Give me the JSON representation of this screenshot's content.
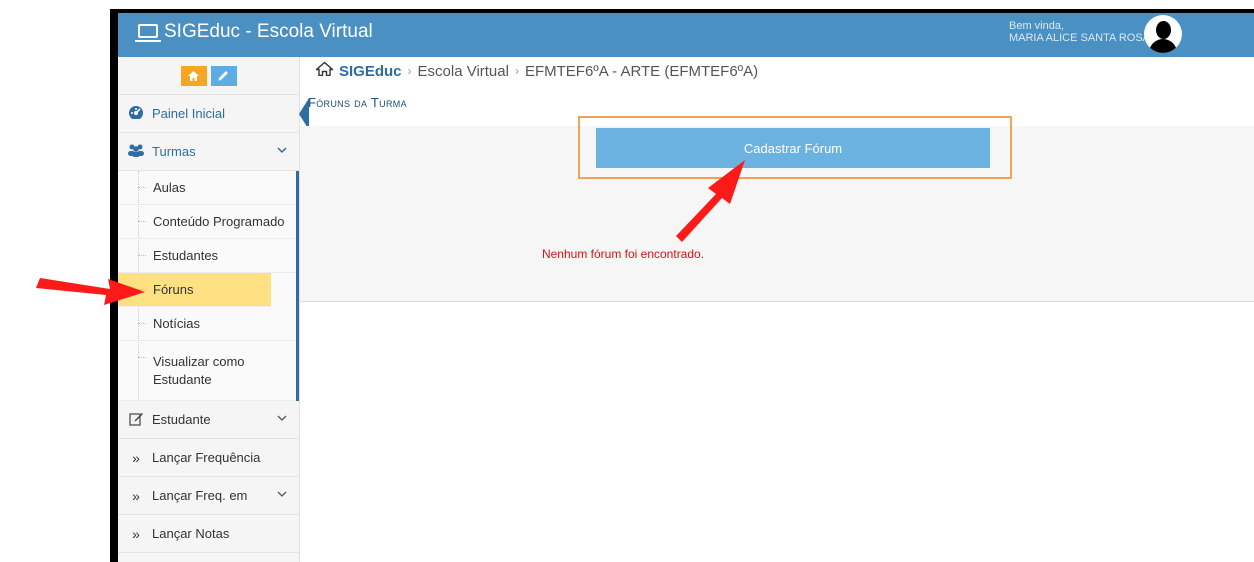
{
  "header": {
    "brand": "SIGEduc - Escola Virtual",
    "greeting": "Bem vinda,",
    "user_name": "MARIA ALICE SANTA ROSA"
  },
  "sidebar": {
    "items": [
      {
        "label": "Painel Inicial",
        "icon": "dashboard-icon"
      },
      {
        "label": "Turmas",
        "icon": "users-icon"
      },
      {
        "label": "Estudante",
        "icon": "edit-icon"
      },
      {
        "label": "Lançar Frequência",
        "icon": "double-chevron-icon"
      },
      {
        "label": "Lançar Freq. em",
        "icon": "double-chevron-icon"
      },
      {
        "label": "Lançar Notas",
        "icon": "double-chevron-icon"
      }
    ],
    "turmas_submenu": [
      "Aulas",
      "Conteúdo Programado",
      "Estudantes",
      "Fóruns",
      "Notícias",
      "Visualizar como Estudante"
    ],
    "active_item": "Fóruns"
  },
  "breadcrumb": {
    "root": "SIGEduc",
    "level1": "Escola Virtual",
    "level2": "EFMTEF6ºA - ARTE (EFMTEF6ºA)"
  },
  "main": {
    "title": "Fóruns da Turma",
    "register_button": "Cadastrar Fórum",
    "empty_message": "Nenhum fórum foi encontrado."
  },
  "colors": {
    "header_bg": "#4a90c2",
    "button_bg": "#6cb2e0",
    "highlight_border": "#f0a15a",
    "active_item_bg": "#ffe082",
    "error_text": "#d11111",
    "annotation_arrow": "#ff0000"
  }
}
